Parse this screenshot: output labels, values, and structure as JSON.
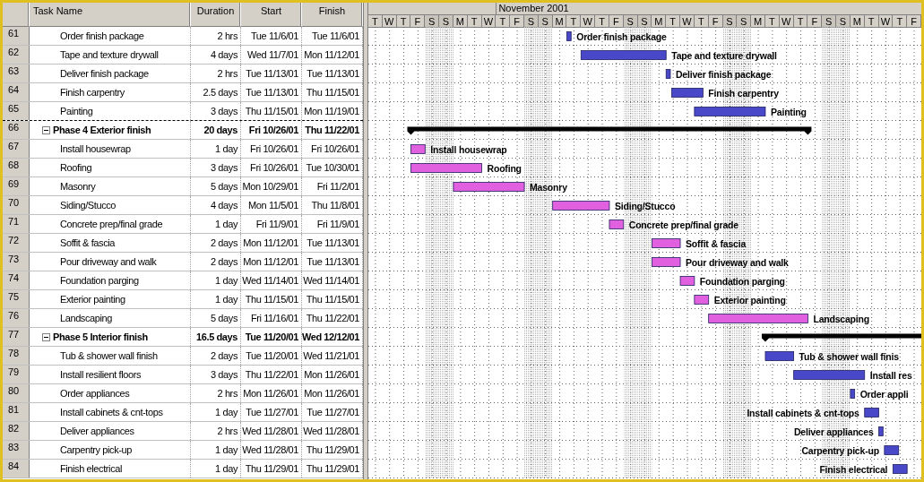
{
  "table": {
    "columns": [
      "Task Name",
      "Duration",
      "Start",
      "Finish"
    ],
    "rows": [
      {
        "id": "61",
        "kind": "task",
        "name": "Order finish package",
        "duration": "2 hrs",
        "start": "Tue 11/6/01",
        "finish": "Tue 11/6/01"
      },
      {
        "id": "62",
        "kind": "task",
        "name": "Tape and texture drywall",
        "duration": "4 days",
        "start": "Wed 11/7/01",
        "finish": "Mon 11/12/01"
      },
      {
        "id": "63",
        "kind": "task",
        "name": "Deliver finish package",
        "duration": "2 hrs",
        "start": "Tue 11/13/01",
        "finish": "Tue 11/13/01"
      },
      {
        "id": "64",
        "kind": "task",
        "name": "Finish carpentry",
        "duration": "2.5 days",
        "start": "Tue 11/13/01",
        "finish": "Thu 11/15/01"
      },
      {
        "id": "65",
        "kind": "task",
        "name": "Painting",
        "duration": "3 days",
        "start": "Thu 11/15/01",
        "finish": "Mon 11/19/01",
        "dashed_below": true
      },
      {
        "id": "66",
        "kind": "summary",
        "expanded": true,
        "name": "Phase 4 Exterior finish",
        "duration": "20 days",
        "start": "Fri 10/26/01",
        "finish": "Thu 11/22/01",
        "children": [
          {
            "id": "67",
            "kind": "task",
            "name": "Install housewrap",
            "duration": "1 day",
            "start": "Fri 10/26/01",
            "finish": "Fri 10/26/01"
          },
          {
            "id": "68",
            "kind": "task",
            "name": "Roofing",
            "duration": "3 days",
            "start": "Fri 10/26/01",
            "finish": "Tue 10/30/01"
          },
          {
            "id": "69",
            "kind": "task",
            "name": "Masonry",
            "duration": "5 days",
            "start": "Mon 10/29/01",
            "finish": "Fri 11/2/01"
          },
          {
            "id": "70",
            "kind": "task",
            "name": "Siding/Stucco",
            "duration": "4 days",
            "start": "Mon 11/5/01",
            "finish": "Thu 11/8/01"
          },
          {
            "id": "71",
            "kind": "task",
            "name": "Concrete prep/final grade",
            "duration": "1 day",
            "start": "Fri 11/9/01",
            "finish": "Fri 11/9/01"
          },
          {
            "id": "72",
            "kind": "task",
            "name": "Soffit & fascia",
            "duration": "2 days",
            "start": "Mon 11/12/01",
            "finish": "Tue 11/13/01"
          },
          {
            "id": "73",
            "kind": "task",
            "name": "Pour driveway and walk",
            "duration": "2 days",
            "start": "Mon 11/12/01",
            "finish": "Tue 11/13/01"
          },
          {
            "id": "74",
            "kind": "task",
            "name": "Foundation parging",
            "duration": "1 day",
            "start": "Wed 11/14/01",
            "finish": "Wed 11/14/01"
          },
          {
            "id": "75",
            "kind": "task",
            "name": "Exterior painting",
            "duration": "1 day",
            "start": "Thu 11/15/01",
            "finish": "Thu 11/15/01"
          },
          {
            "id": "76",
            "kind": "task",
            "name": "Landscaping",
            "duration": "5 days",
            "start": "Fri 11/16/01",
            "finish": "Thu 11/22/01"
          }
        ]
      },
      {
        "id": "77",
        "kind": "summary",
        "expanded": true,
        "name": "Phase 5 Interior finish",
        "duration": "16.5 days",
        "start": "Tue 11/20/01",
        "finish": "Wed 12/12/01",
        "children": [
          {
            "id": "78",
            "kind": "task",
            "name": "Tub & shower wall finish",
            "duration": "2 days",
            "start": "Tue 11/20/01",
            "finish": "Wed 11/21/01"
          },
          {
            "id": "79",
            "kind": "task",
            "name": "Install resilient floors",
            "duration": "3 days",
            "start": "Thu 11/22/01",
            "finish": "Mon 11/26/01"
          },
          {
            "id": "80",
            "kind": "task",
            "name": "Order appliances",
            "duration": "2 hrs",
            "start": "Mon 11/26/01",
            "finish": "Mon 11/26/01"
          },
          {
            "id": "81",
            "kind": "task",
            "name": "Install cabinets & cnt-tops",
            "duration": "1 day",
            "start": "Tue 11/27/01",
            "finish": "Tue 11/27/01"
          },
          {
            "id": "82",
            "kind": "task",
            "name": "Deliver appliances",
            "duration": "2 hrs",
            "start": "Wed 11/28/01",
            "finish": "Wed 11/28/01"
          },
          {
            "id": "83",
            "kind": "task",
            "name": "Carpentry pick-up",
            "duration": "1 day",
            "start": "Wed 11/28/01",
            "finish": "Thu 11/29/01"
          },
          {
            "id": "84",
            "kind": "task",
            "name": "Finish electrical",
            "duration": "1 day",
            "start": "Thu 11/29/01",
            "finish": "Thu 11/29/01"
          }
        ]
      }
    ]
  },
  "gantt": {
    "timescale": {
      "previous_month_days": [
        {
          "label": "T",
          "weekend": false
        },
        {
          "label": "W",
          "weekend": false
        },
        {
          "label": "T",
          "weekend": false
        },
        {
          "label": "F",
          "weekend": false
        },
        {
          "label": "S",
          "weekend": true
        },
        {
          "label": "S",
          "weekend": true
        },
        {
          "label": "M",
          "weekend": false
        },
        {
          "label": "T",
          "weekend": false
        },
        {
          "label": "W",
          "weekend": false
        }
      ],
      "months": [
        {
          "label": "November 2001",
          "days": [
            {
              "label": "T",
              "weekend": false
            },
            {
              "label": "F",
              "weekend": false
            },
            {
              "label": "S",
              "weekend": true
            },
            {
              "label": "S",
              "weekend": true
            },
            {
              "label": "M",
              "weekend": false
            },
            {
              "label": "T",
              "weekend": false
            },
            {
              "label": "W",
              "weekend": false
            },
            {
              "label": "T",
              "weekend": false
            },
            {
              "label": "F",
              "weekend": false
            },
            {
              "label": "S",
              "weekend": true
            },
            {
              "label": "S",
              "weekend": true
            },
            {
              "label": "M",
              "weekend": false
            },
            {
              "label": "T",
              "weekend": false
            },
            {
              "label": "W",
              "weekend": false
            },
            {
              "label": "T",
              "weekend": false
            },
            {
              "label": "F",
              "weekend": false
            },
            {
              "label": "S",
              "weekend": true
            },
            {
              "label": "S",
              "weekend": true
            },
            {
              "label": "M",
              "weekend": false
            },
            {
              "label": "T",
              "weekend": false
            },
            {
              "label": "W",
              "weekend": false
            },
            {
              "label": "T",
              "weekend": false
            },
            {
              "label": "F",
              "weekend": false
            },
            {
              "label": "S",
              "weekend": true
            },
            {
              "label": "S",
              "weekend": true
            },
            {
              "label": "M",
              "weekend": false
            },
            {
              "label": "T",
              "weekend": false
            },
            {
              "label": "W",
              "weekend": false
            },
            {
              "label": "T",
              "weekend": false
            },
            {
              "label": "F",
              "weekend": false
            }
          ]
        }
      ]
    },
    "bars": [
      {
        "kind": "task",
        "color": "#4848c8",
        "label": "Order finish package",
        "label_left": false
      },
      {
        "kind": "task",
        "color": "#4848c8",
        "label": "Tape and texture drywall",
        "label_left": false
      },
      {
        "kind": "task",
        "color": "#4848c8",
        "label": "Deliver finish package",
        "label_left": false
      },
      {
        "kind": "task",
        "color": "#4848c8",
        "label": "Finish carpentry",
        "label_left": false
      },
      {
        "kind": "task",
        "color": "#4848c8",
        "label": "Painting",
        "label_left": false
      },
      {
        "kind": "summary"
      },
      {
        "kind": "task",
        "color": "#e060e0",
        "label": "Install housewrap",
        "label_left": false
      },
      {
        "kind": "task",
        "color": "#e060e0",
        "label": "Roofing",
        "label_left": false
      },
      {
        "kind": "task",
        "color": "#e060e0",
        "label": "Masonry",
        "label_left": false
      },
      {
        "kind": "task",
        "color": "#e060e0",
        "label": "Siding/Stucco",
        "label_left": false
      },
      {
        "kind": "task",
        "color": "#e060e0",
        "label": "Concrete prep/final grade",
        "label_left": false
      },
      {
        "kind": "task",
        "color": "#e060e0",
        "label": "Soffit & fascia",
        "label_left": false
      },
      {
        "kind": "task",
        "color": "#e060e0",
        "label": "Pour driveway and walk",
        "label_left": false
      },
      {
        "kind": "task",
        "color": "#e060e0",
        "label": "Foundation parging",
        "label_left": false
      },
      {
        "kind": "task",
        "color": "#e060e0",
        "label": "Exterior painting",
        "label_left": false
      },
      {
        "kind": "task",
        "color": "#e060e0",
        "label": "Landscaping",
        "label_left": false
      },
      {
        "kind": "summary"
      },
      {
        "kind": "task",
        "color": "#4848c8",
        "label": "Tub & shower wall finis",
        "label_left": false
      },
      {
        "kind": "task",
        "color": "#4848c8",
        "label": "Install res",
        "label_left": false
      },
      {
        "kind": "task",
        "color": "#4848c8",
        "label": "Order appli",
        "label_left": false
      },
      {
        "kind": "task",
        "color": "#4848c8",
        "label": "Install cabinets & cnt-tops",
        "label_left": true
      },
      {
        "kind": "task",
        "color": "#4848c8",
        "label": "Deliver appliances",
        "label_left": true
      },
      {
        "kind": "task",
        "color": "#4848c8",
        "label": "Carpentry pick-up",
        "label_left": true
      },
      {
        "kind": "task",
        "color": "#4848c8",
        "label": "Finish electrical",
        "label_left": true
      }
    ]
  }
}
